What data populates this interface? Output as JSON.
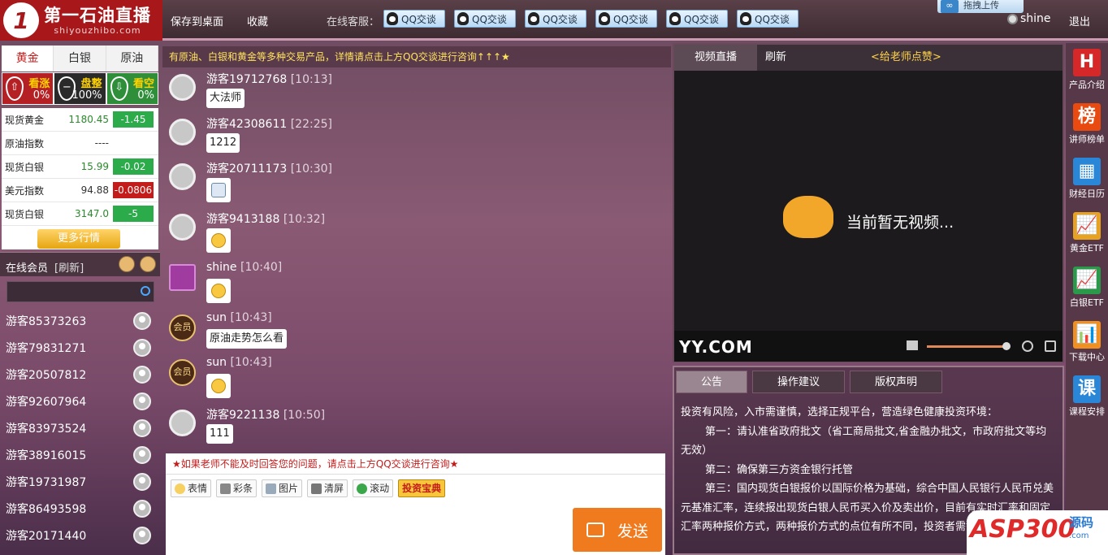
{
  "header": {
    "logo_title": "第一石油直播",
    "logo_url": "shiyouzhibo.com",
    "save_desktop": "保存到桌面",
    "favorite": "收藏",
    "cs_label": "在线客服：",
    "qq_buttons": [
      "QQ交谈",
      "QQ交谈",
      "QQ交谈",
      "QQ交谈",
      "QQ交谈",
      "QQ交谈"
    ],
    "upload": "拖拽上传",
    "username": "shine",
    "logout": "退出"
  },
  "market": {
    "tabs": [
      "黄金",
      "白银",
      "原油"
    ],
    "sentiment": [
      {
        "label": "看涨",
        "percent": "0%"
      },
      {
        "label": "盘整",
        "percent": "100%"
      },
      {
        "label": "看空",
        "percent": "0%"
      }
    ],
    "quotes": [
      {
        "name": "现货黄金",
        "price": "1180.45",
        "change": "-1.45"
      },
      {
        "name": "原油指数",
        "price": "----",
        "change": ""
      },
      {
        "name": "现货白银",
        "price": "15.99",
        "change": "-0.02"
      },
      {
        "name": "美元指数",
        "price": "94.88",
        "change": "-0.0806"
      },
      {
        "name": "现货白银",
        "price": "3147.0",
        "change": "-5"
      }
    ],
    "more": "更多行情"
  },
  "members": {
    "title": "在线会员",
    "refresh": "[刷新]",
    "list": [
      "游客85373263",
      "游客79831271",
      "游客20507812",
      "游客92607964",
      "游客83973524",
      "游客38916015",
      "游客19731987",
      "游客86493598",
      "游客20171440"
    ]
  },
  "chat": {
    "marquee": "有原油、白银和黄金等多种交易产品，详情请点击上方QQ交谈进行咨询↑↑↑★",
    "messages": [
      {
        "user": "游客19712768",
        "time": "[10:13]",
        "text": "大法师"
      },
      {
        "user": "游客42308611",
        "time": "[22:25]",
        "text": "1212"
      },
      {
        "user": "游客20711173",
        "time": "[10:30]",
        "text": ""
      },
      {
        "user": "游客9413188",
        "time": "[10:32]",
        "text": ""
      },
      {
        "user": "shine",
        "time": "[10:40]",
        "text": ""
      },
      {
        "user": "sun",
        "time": "[10:43]",
        "text": "原油走势怎么看",
        "badge": "会员"
      },
      {
        "user": "sun",
        "time": "[10:43]",
        "text": "",
        "badge": "会员"
      },
      {
        "user": "游客9221138",
        "time": "[10:50]",
        "text": "111"
      }
    ],
    "notice": "★如果老师不能及时回答您的问题，请点击上方QQ交谈进行咨询★",
    "tools": [
      "表情",
      "彩条",
      "图片",
      "清屏",
      "滚动"
    ],
    "invest_tool": "投资宝典",
    "send": "发送"
  },
  "video": {
    "tab_live": "视频直播",
    "tab_refresh": "刷新",
    "like": "<给老师点赞>",
    "no_video": "当前暂无视频...",
    "brand": "YY.COM",
    "volume": 0.98
  },
  "announcement": {
    "tabs": [
      "公告",
      "操作建议",
      "版权声明"
    ],
    "lines": [
      "投资有风险，入市需谨慎，选择正规平台，营造绿色健康投资环境：",
      "第一：请认准省政府批文（省工商局批文,省金融办批文，市政府批文等均无效）",
      "第二：确保第三方资金银行托管",
      "第三：国内现货白银报价以国际价格为基础，综合中国人民银行人民币兑美元基准汇率，连续报出现货白银人民币买入价及卖出价，目前有实时汇率和固定汇率两种报价方式，两种报价方式的点位有所不同，投资者需警惕。"
    ]
  },
  "sidebar": {
    "items": [
      {
        "label": "产品介绍",
        "glyph": "H",
        "color": "#d62828"
      },
      {
        "label": "讲师榜单",
        "glyph": "榜",
        "color": "#e84a10"
      },
      {
        "label": "财经日历",
        "glyph": "▦",
        "color": "#2a86d6"
      },
      {
        "label": "黄金ETF",
        "glyph": "📈",
        "color": "#e6a220"
      },
      {
        "label": "白银ETF",
        "glyph": "📈",
        "color": "#2a9a4a"
      },
      {
        "label": "下载中心",
        "glyph": "📊",
        "color": "#f09020"
      },
      {
        "label": "课程安排",
        "glyph": "课",
        "color": "#2a86d6"
      }
    ]
  },
  "watermark": {
    "brand": "ASP300",
    "cn": "源码",
    "url": ".com"
  }
}
